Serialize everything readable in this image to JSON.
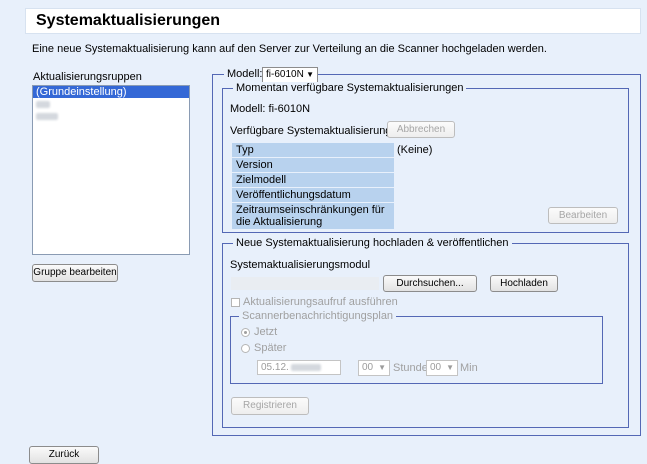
{
  "page": {
    "title": "Systemaktualisierungen",
    "description": "Eine neue Systemaktualisierung kann auf den Server zur Verteilung an die Scanner hochgeladen werden."
  },
  "groups": {
    "label": "Aktualisierungsruppen",
    "items": [
      {
        "label": "(Grundeinstellung)",
        "selected": true
      },
      {
        "label": "",
        "selected": false
      },
      {
        "label": "",
        "selected": false
      }
    ],
    "edit_button": "Gruppe bearbeiten"
  },
  "model_select": {
    "label": "Modell:",
    "value": "fi-6010N"
  },
  "current_updates": {
    "legend": "Momentan verfügbare Systemaktualisierungen",
    "model_line": "Modell: fi-6010N",
    "available_label": "Verfügbare Systemaktualisierung",
    "cancel_button": "Abbrechen",
    "rows": [
      {
        "label": "Typ",
        "value": "(Keine)"
      },
      {
        "label": "Version",
        "value": ""
      },
      {
        "label": "Zielmodell",
        "value": ""
      },
      {
        "label": "Veröffentlichungsdatum",
        "value": ""
      },
      {
        "label": "Zeitraumseinschränkungen für die Aktualisierung",
        "value": ""
      }
    ],
    "edit_button": "Bearbeiten"
  },
  "upload": {
    "legend": "Neue Systemaktualisierung hochladen & veröffentlichen",
    "module_label": "Systemaktualisierungsmodul",
    "file_value": "",
    "browse_button": "Durchsuchen...",
    "upload_button": "Hochladen",
    "run_checkbox_label": "Aktualisierungsaufruf ausführen",
    "notify_legend": "Scannerbenachrichtigungsplan",
    "now_label": "Jetzt",
    "later_label": "Später",
    "date_value": "05.12.",
    "hour_value": "00",
    "hour_label": "Stunde",
    "minute_value": "00",
    "minute_label": "Min",
    "register_button": "Registrieren"
  },
  "back_button": "Zurück"
}
